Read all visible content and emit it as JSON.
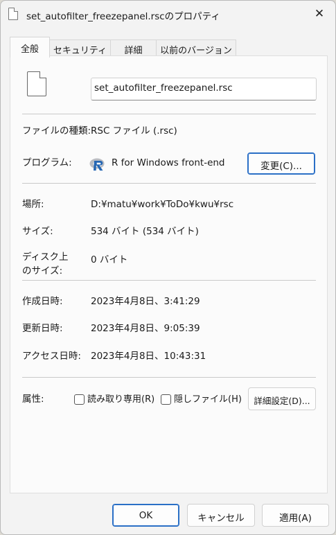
{
  "window": {
    "title": "set_autofilter_freezepanel.rscのプロパティ"
  },
  "tabs": [
    {
      "label": "全般"
    },
    {
      "label": "セキュリティ"
    },
    {
      "label": "詳細"
    },
    {
      "label": "以前のバージョン"
    }
  ],
  "file": {
    "name": "set_autofilter_freezepanel.rsc"
  },
  "fields": {
    "type_label": "ファイルの種類:",
    "type_value": "RSC ファイル (.rsc)",
    "program_label": "プログラム:",
    "program_value": "R for Windows front-end",
    "change_button": "変更(C)...",
    "location_label": "場所:",
    "location_value": "D:¥matu¥work¥ToDo¥kwu¥rsc",
    "size_label": "サイズ:",
    "size_value": "534 バイト (534 バイト)",
    "disk_size_label_1": "ディスク上",
    "disk_size_label_2": "のサイズ:",
    "disk_size_value": "0 バイト",
    "created_label": "作成日時:",
    "created_value": "2023年4月8日、3:41:29",
    "modified_label": "更新日時:",
    "modified_value": "2023年4月8日、9:05:39",
    "accessed_label": "アクセス日時:",
    "accessed_value": "2023年4月8日、10:43:31",
    "attributes_label": "属性:",
    "readonly_label": "読み取り専用(R)",
    "readonly_checked": false,
    "hidden_label": "隠しファイル(H)",
    "hidden_checked": false,
    "advanced_button": "詳細設定(D)..."
  },
  "footer": {
    "ok": "OK",
    "cancel": "キャンセル",
    "apply": "適用(A)"
  },
  "colors": {
    "accent": "#2a6fc6",
    "window_bg": "#f3f3f3",
    "panel_bg": "#fbfbfb"
  }
}
